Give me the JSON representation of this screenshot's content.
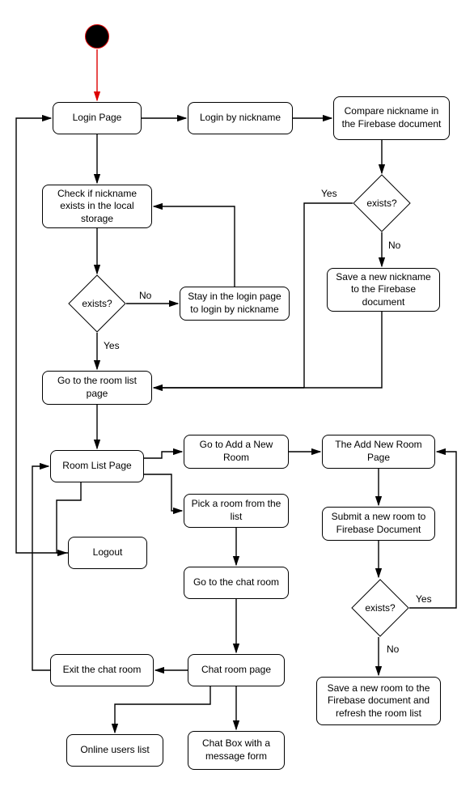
{
  "nodes": {
    "login_page": "Login Page",
    "login_by_nickname": "Login by nickname",
    "compare_nickname": "Compare nickname in the Firebase document",
    "check_local": "Check if nickname exists in the local storage",
    "stay_login": "Stay in the login page to login by nickname",
    "save_nickname": "Save a new nickname to the Firebase document",
    "go_room_list": "Go  to the room list page",
    "room_list_page": "Room List Page",
    "go_add_room": "Go to Add a New Room",
    "add_room_page": "The Add New Room Page",
    "pick_room": "Pick a room from the list",
    "logout": "Logout",
    "submit_room": "Submit a new room to Firebase Document",
    "go_chat_room": "Go to the chat room",
    "exit_chat": "Exit the chat room",
    "chat_room_page": "Chat room page",
    "save_room": "Save a new room to the Firebase document and refresh the room list",
    "online_users": "Online users list",
    "chat_box": "Chat Box with a message form"
  },
  "decisions": {
    "exists1": "exists?",
    "exists2": "exists?",
    "exists3": "exists?"
  },
  "edge_labels": {
    "yes1": "Yes",
    "no1": "No",
    "yes2": "Yes",
    "no2": "No",
    "yes3": "Yes",
    "no3": "No"
  }
}
